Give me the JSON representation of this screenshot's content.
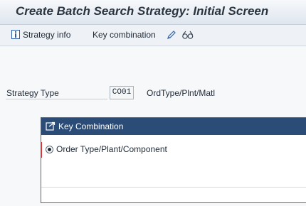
{
  "window": {
    "title": "Create Batch Search Strategy: Initial Screen"
  },
  "toolbar": {
    "strategy_info_label": "Strategy info",
    "key_combination_label": "Key combination",
    "icons": [
      "info-icon",
      "pencil-icon",
      "glasses-icon"
    ]
  },
  "form": {
    "strategy_type_label": "Strategy Type",
    "strategy_type_value": "CO01",
    "strategy_type_desc": "OrdType/Plnt/Matl"
  },
  "dialog": {
    "title": "Key Combination",
    "options": [
      {
        "label": "Order Type/Plant/Component",
        "selected": true
      }
    ]
  },
  "colors": {
    "dialog_header": "#2c4c78",
    "title_text": "#2b3540",
    "focus_marker": "#d33a3a"
  }
}
